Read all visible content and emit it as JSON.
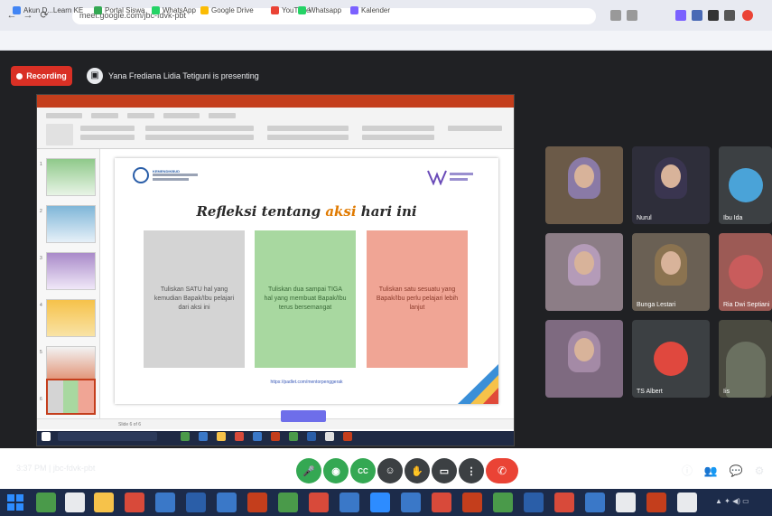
{
  "browser": {
    "url": "meet.google.com/jbc-fdvk-pbt",
    "nav": {
      "back": "←",
      "forward": "→",
      "reload": "⟳"
    },
    "bookmarks": [
      {
        "label": "Akun D...Learn KE",
        "color": "#4285f4"
      },
      {
        "label": "Portal Siswa",
        "color": "#34a853"
      },
      {
        "label": "WhatsApp",
        "color": "#25d366"
      },
      {
        "label": "Google Drive",
        "color": "#fbbc04"
      },
      {
        "label": "YouTube",
        "color": "#ea4335"
      },
      {
        "label": "Whatsapp",
        "color": "#25d366"
      },
      {
        "label": "Kalender",
        "color": "#7b61ff"
      }
    ]
  },
  "meet": {
    "recording_label": "Recording",
    "presenter_text": "Yana Frediana Lidia Tetiguni is presenting",
    "meeting_time": "3:37 PM  |  jbc-fdvk-pbt",
    "controls": {
      "mic": "🎤",
      "cam": "◉",
      "captions": "CC",
      "emoji": "☺",
      "present": "▭",
      "raise_hand": "✋",
      "more": "⋮",
      "end_call": "✆"
    },
    "side_controls": {
      "info": "ⓘ",
      "people": "👥",
      "chat": "💬",
      "activities": "⚙"
    },
    "participants": [
      {
        "name": "",
        "bg": "#6b5a48",
        "type": "hijab",
        "hijab_color": "#8a7aa6"
      },
      {
        "name": "Nurul",
        "bg": "#2e2e3a",
        "type": "hijab",
        "hijab_color": "#3a3550"
      },
      {
        "name": "Ibu Ida",
        "bg": "#3c4043",
        "type": "avatar",
        "avatar_color": "#4aa3d8"
      },
      {
        "name": "",
        "bg": "#8c7d86",
        "type": "hijab",
        "hijab_color": "#b49bb8"
      },
      {
        "name": "Bunga Lestari",
        "bg": "#6a6054",
        "type": "hijab",
        "hijab_color": "#8b7350"
      },
      {
        "name": "Ria Dwi Septiani",
        "bg": "#9c5a55",
        "type": "avatar",
        "avatar_color": "#c95c5c"
      },
      {
        "name": "",
        "bg": "#7e6a80",
        "type": "hijab",
        "hijab_color": "#a48aa6"
      },
      {
        "name": "TS Albert",
        "bg": "#3c4043",
        "type": "avatar",
        "avatar_color": "#e0483e"
      },
      {
        "name": "Iis",
        "bg": "#4a4a40",
        "type": "person",
        "person_color": "#6a7060"
      }
    ]
  },
  "slide": {
    "ministry": "KEMENDIKBUD",
    "title_pre": "Refleksi",
    "title_mid": " tentang ",
    "title_hl": "aksi",
    "title_post": " hari ini",
    "card1": "Tuliskan SATU hal yang kemudian Bapak/Ibu pelajari dari aksi ini",
    "card2": "Tuliskan dua sampai TIGA hal yang membuat Bapak/Ibu terus bersemangat",
    "card3": "Tuliskan satu sesuatu yang Bapak/Ibu perlu pelajari lebih lanjut",
    "link": "https://padlet.com/mentorpenggerak",
    "status": "Slide 6 of 6"
  },
  "thumbs": [
    "1",
    "2",
    "3",
    "4",
    "5",
    "6"
  ],
  "colors": {
    "ppt_accent": "#c43e1c",
    "meet_bg": "#202124",
    "recording": "#d93025",
    "end_call": "#ea4335",
    "control_green": "#34a853"
  }
}
